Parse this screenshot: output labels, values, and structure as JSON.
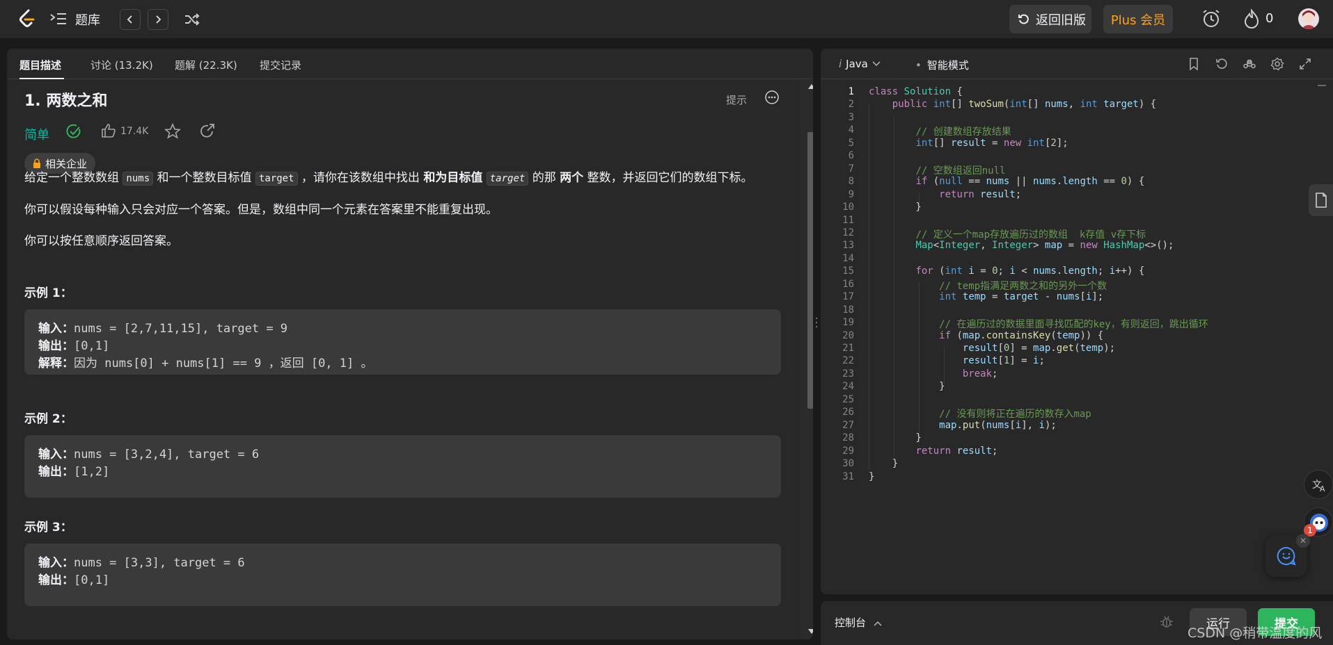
{
  "nav": {
    "title": "题库",
    "old_version_label": "返回旧版",
    "plus_label": "Plus 会员",
    "streak_count": "0"
  },
  "problem_tabs": [
    {
      "label": "题目描述"
    },
    {
      "label": "讨论 (13.2K)"
    },
    {
      "label": "题解 (22.3K)"
    },
    {
      "label": "提交记录"
    }
  ],
  "problem": {
    "title": "1. 两数之和",
    "hint_label": "提示",
    "difficulty": "简单",
    "difficulty_color": "#00b8a3",
    "likes": "17.4K",
    "company_tag": "相关企业",
    "desc": {
      "p1_a": "给定一个整数数组",
      "p1_nums": "nums",
      "p1_b": "和一个整数目标值",
      "p1_target": "target",
      "p1_c": "，请你在该数组中找出",
      "p1_bold": "和为目标值",
      "p1_target2": "target",
      "p1_d": "的那",
      "p1_bold2": "两个",
      "p1_e": "整数，并返回它们的数组下标。",
      "p2": "你可以假设每种输入只会对应一个答案。但是，数组中同一个元素在答案里不能重复出现。",
      "p3": "你可以按任意顺序返回答案。"
    },
    "examples": [
      {
        "title": "示例 1：",
        "input_label": "输入：",
        "input": "nums = [2,7,11,15], target = 9",
        "output_label": "输出：",
        "output": "[0,1]",
        "explain_label": "解释：",
        "explain": "因为 nums[0] + nums[1] == 9 ，返回 [0, 1] 。"
      },
      {
        "title": "示例 2：",
        "input_label": "输入：",
        "input": "nums = [3,2,4], target = 6",
        "output_label": "输出：",
        "output": "[1,2]"
      },
      {
        "title": "示例 3：",
        "input_label": "输入：",
        "input": "nums = [3,3], target = 6",
        "output_label": "输出：",
        "output": "[0,1]"
      }
    ]
  },
  "editor": {
    "language": "Java",
    "mode_label": "智能模式",
    "code_lines": [
      "class Solution {",
      "    public int[] twoSum(int[] nums, int target) {",
      "",
      "        // 创建数组存放结果",
      "        int[] result = new int[2];",
      "",
      "        // 空数组返回null",
      "        if (null == nums || nums.length == 0) {",
      "            return result;",
      "        }",
      "",
      "        // 定义一个map存放遍历过的数组  k存值 v存下标",
      "        Map<Integer, Integer> map = new HashMap<>();",
      "",
      "        for (int i = 0; i < nums.length; i++) {",
      "            // temp指满足两数之和的另外一个数",
      "            int temp = target - nums[i];",
      "",
      "            // 在遍历过的数据里面寻找匹配的key，有则返回，跳出循环",
      "            if (map.containsKey(temp)) {",
      "                result[0] = map.get(temp);",
      "                result[1] = i;",
      "                break;",
      "            }",
      "",
      "            // 没有则将正在遍历的数存入map",
      "            map.put(nums[i], i);",
      "        }",
      "        return result;",
      "    }",
      "}"
    ]
  },
  "console": {
    "label": "控制台",
    "run_label": "运行",
    "submit_label": "提交"
  },
  "bot_badge": "1",
  "watermark": "CSDN @稍带温度的风"
}
